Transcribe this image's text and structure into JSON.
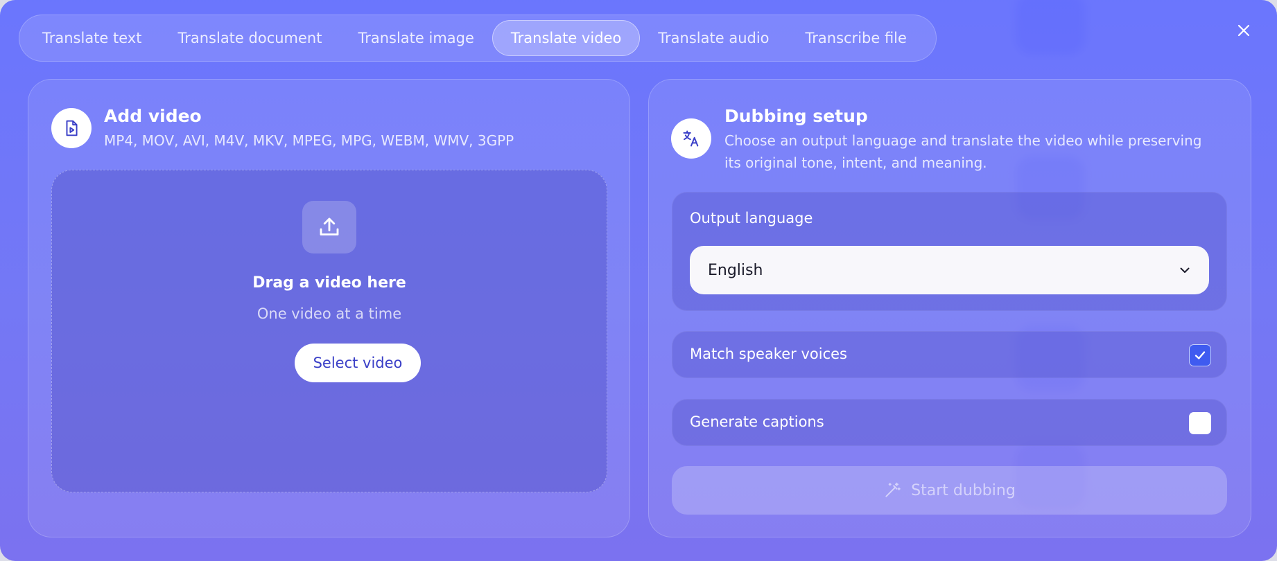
{
  "tabs": [
    {
      "label": "Translate text"
    },
    {
      "label": "Translate document"
    },
    {
      "label": "Translate image"
    },
    {
      "label": "Translate video"
    },
    {
      "label": "Translate audio"
    },
    {
      "label": "Transcribe file"
    }
  ],
  "active_tab": "Translate video",
  "close_icon": "close-icon",
  "add_video": {
    "title": "Add video",
    "formats": "MP4, MOV, AVI, M4V, MKV, MPEG, MPG, WEBM, WMV, 3GPP",
    "icon": "video-file-icon"
  },
  "dropzone": {
    "title": "Drag a video here",
    "subtitle": "One video at a time",
    "button_label": "Select video",
    "icon": "upload-icon"
  },
  "dubbing": {
    "title": "Dubbing setup",
    "description_line1": "Choose an output language and translate the video while preserving",
    "description_line2": "its original tone, intent, and meaning.",
    "icon": "translate-icon"
  },
  "output_language": {
    "label": "Output language",
    "value": "English"
  },
  "options": {
    "match_speaker_voices": {
      "label": "Match speaker voices",
      "checked": true
    },
    "generate_captions": {
      "label": "Generate captions",
      "checked": false
    }
  },
  "start_button": {
    "label": "Start dubbing",
    "icon": "magic-wand-icon",
    "enabled": false
  },
  "colors": {
    "modal_top": "#626eff",
    "modal_bottom": "#766cf0",
    "accent_checkbox": "#3f5bf0",
    "button_text": "#3a3fc7"
  }
}
